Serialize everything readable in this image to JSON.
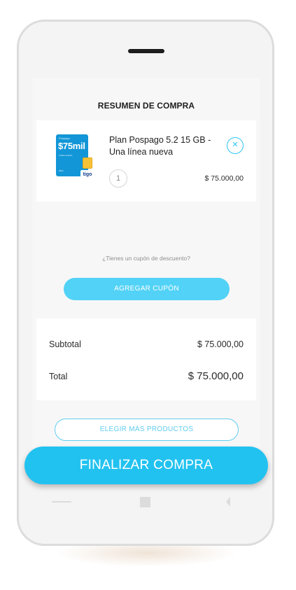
{
  "screen": {
    "title": "RESUMEN DE COMPRA"
  },
  "product": {
    "name": "Plan Pospago 5.2 15 GB - Una línea nueva",
    "quantity": "1",
    "price": "$ 75.000,00",
    "remove_icon": "close-icon",
    "image": {
      "small_label": "Pospago",
      "amount": "$75mil",
      "line_label": "LINEA NUEVA",
      "footer": "MES",
      "brand": "tigo"
    }
  },
  "coupon": {
    "question": "¿Tienes un cupón de descuento?",
    "button_label": "AGREGAR CUPÓN"
  },
  "summary": {
    "subtotal_label": "Subtotal",
    "subtotal_value": "$ 75.000,00",
    "total_label": "Total",
    "total_value": "$ 75.000,00"
  },
  "actions": {
    "more_products_label": "ELEGIR MÁS PRODUCTOS",
    "checkout_label": "FINALIZAR COMPRA"
  },
  "colors": {
    "accent": "#22c2f0",
    "accent_light": "#52d2f6",
    "sim_blue": "#1296d7"
  },
  "nav_icons": [
    "back-icon",
    "home-icon",
    "recent-apps-icon"
  ]
}
